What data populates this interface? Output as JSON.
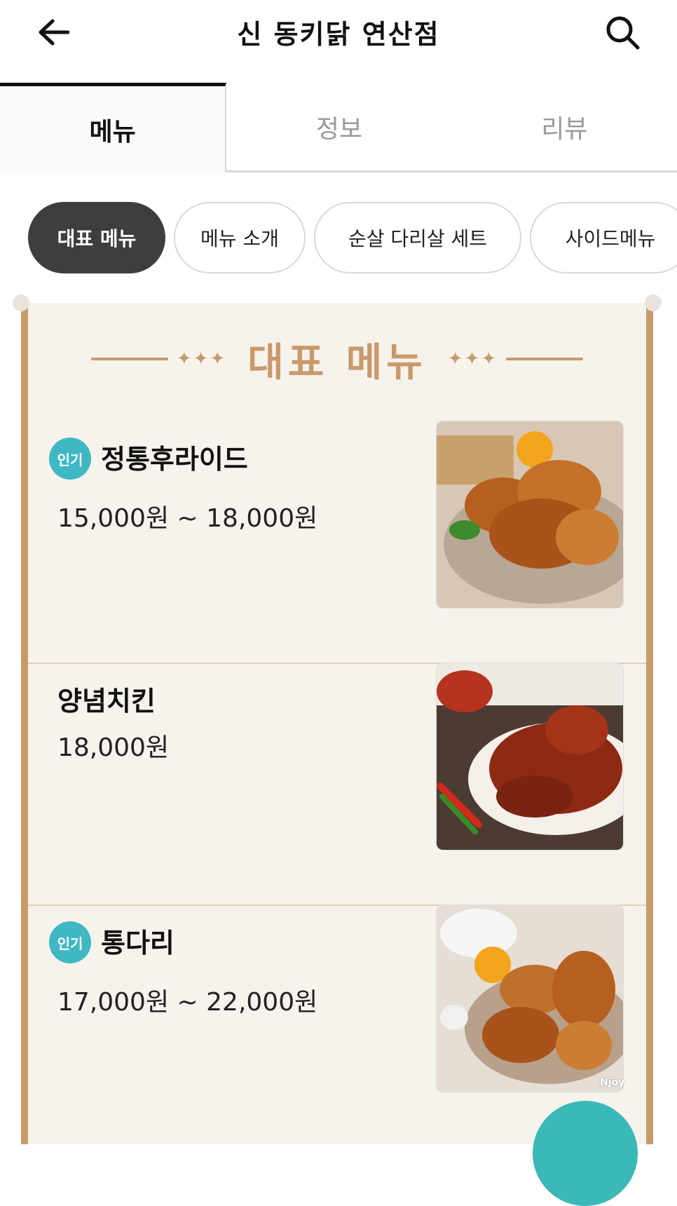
{
  "header": {
    "title": "신 동키닭 연산점",
    "back_icon": "arrow-left-icon",
    "search_icon": "search-icon"
  },
  "tabs": [
    {
      "label": "메뉴",
      "active": true
    },
    {
      "label": "정보",
      "active": false
    },
    {
      "label": "리뷰",
      "active": false
    }
  ],
  "chips": [
    {
      "label": "대표 메뉴",
      "active": true
    },
    {
      "label": "메뉴 소개",
      "active": false
    },
    {
      "label": "순살 다리살 세트",
      "active": false
    },
    {
      "label": "사이드메뉴",
      "active": false
    }
  ],
  "board": {
    "title": "대표 메뉴",
    "decoration": "✦✦✦",
    "colors": {
      "accent": "#c89a6a",
      "badge": "#3fb8c4",
      "chip_active": "#3e3e3e"
    }
  },
  "items": [
    {
      "badge": "인기",
      "name": "정통후라이드",
      "price": "15,000원 ~ 18,000원",
      "image": "fried-chicken-photo"
    },
    {
      "badge": "",
      "name": "양념치킨",
      "price": "18,000원",
      "image": "seasoned-chicken-photo"
    },
    {
      "badge": "인기",
      "name": "통다리",
      "price": "17,000원 ~ 22,000원",
      "image": "drumstick-chicken-photo"
    }
  ],
  "watermark": "Njoy"
}
